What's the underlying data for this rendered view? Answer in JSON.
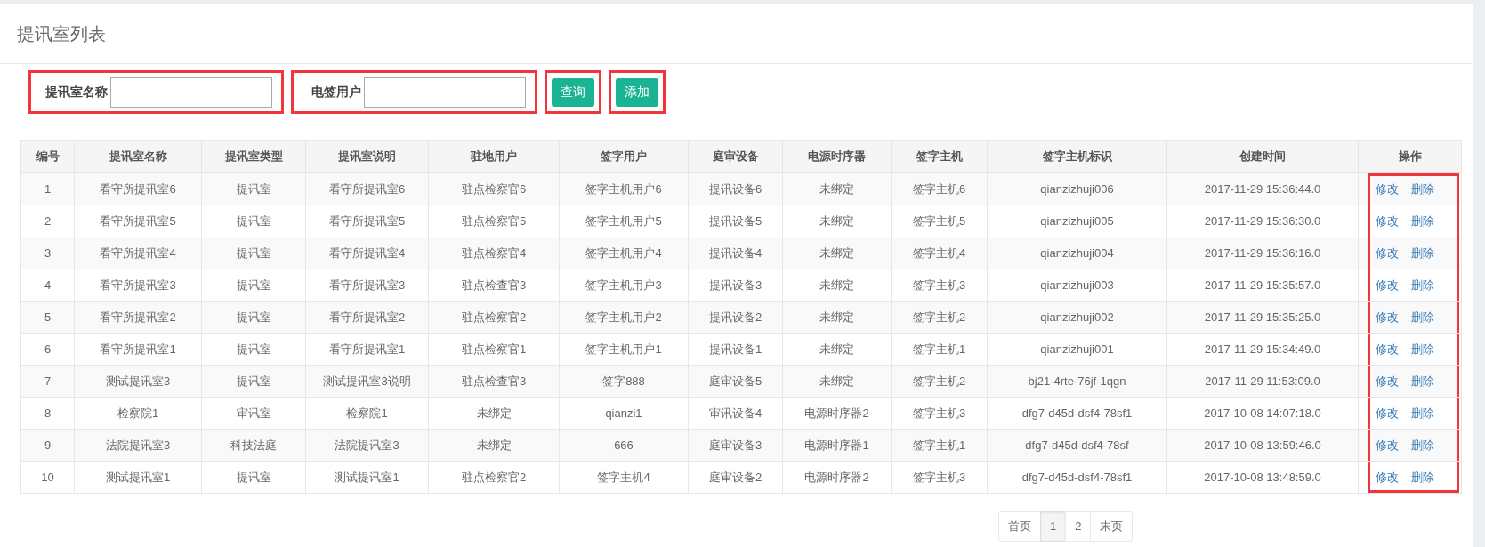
{
  "page": {
    "title": "提讯室列表"
  },
  "filters": [
    {
      "label": "提讯室名称",
      "highlighted": true
    },
    {
      "label": "电签用户",
      "highlighted": true
    }
  ],
  "buttons": [
    {
      "label": "查询",
      "highlighted": true
    },
    {
      "label": "添加",
      "highlighted": true
    }
  ],
  "table": {
    "columns": [
      "编号",
      "提讯室名称",
      "提讯室类型",
      "提讯室说明",
      "驻地用户",
      "签字用户",
      "庭审设备",
      "电源时序器",
      "签字主机",
      "签字主机标识",
      "创建时间",
      "操作"
    ],
    "actions_highlighted": true,
    "rows": [
      {
        "cells": [
          "1",
          "看守所提讯室6",
          "提讯室",
          "看守所提讯室6",
          "驻点检察官6",
          "签字主机用户6",
          "提讯设备6",
          "未绑定",
          "签字主机6",
          "qianzizhuji006",
          "2017-11-29 15:36:44.0"
        ],
        "actions": [
          "修改",
          "删除"
        ]
      },
      {
        "cells": [
          "2",
          "看守所提讯室5",
          "提讯室",
          "看守所提讯室5",
          "驻点检察官5",
          "签字主机用户5",
          "提讯设备5",
          "未绑定",
          "签字主机5",
          "qianzizhuji005",
          "2017-11-29 15:36:30.0"
        ],
        "actions": [
          "修改",
          "删除"
        ]
      },
      {
        "cells": [
          "3",
          "看守所提讯室4",
          "提讯室",
          "看守所提讯室4",
          "驻点检察官4",
          "签字主机用户4",
          "提讯设备4",
          "未绑定",
          "签字主机4",
          "qianzizhuji004",
          "2017-11-29 15:36:16.0"
        ],
        "actions": [
          "修改",
          "删除"
        ]
      },
      {
        "cells": [
          "4",
          "看守所提讯室3",
          "提讯室",
          "看守所提讯室3",
          "驻点检查官3",
          "签字主机用户3",
          "提讯设备3",
          "未绑定",
          "签字主机3",
          "qianzizhuji003",
          "2017-11-29 15:35:57.0"
        ],
        "actions": [
          "修改",
          "删除"
        ]
      },
      {
        "cells": [
          "5",
          "看守所提讯室2",
          "提讯室",
          "看守所提讯室2",
          "驻点检察官2",
          "签字主机用户2",
          "提讯设备2",
          "未绑定",
          "签字主机2",
          "qianzizhuji002",
          "2017-11-29 15:35:25.0"
        ],
        "actions": [
          "修改",
          "删除"
        ]
      },
      {
        "cells": [
          "6",
          "看守所提讯室1",
          "提讯室",
          "看守所提讯室1",
          "驻点检察官1",
          "签字主机用户1",
          "提讯设备1",
          "未绑定",
          "签字主机1",
          "qianzizhuji001",
          "2017-11-29 15:34:49.0"
        ],
        "actions": [
          "修改",
          "删除"
        ]
      },
      {
        "cells": [
          "7",
          "测试提讯室3",
          "提讯室",
          "测试提讯室3说明",
          "驻点检查官3",
          "签字888",
          "庭审设备5",
          "未绑定",
          "签字主机2",
          "bj21-4rte-76jf-1qgn",
          "2017-11-29 11:53:09.0"
        ],
        "actions": [
          "修改",
          "删除"
        ]
      },
      {
        "cells": [
          "8",
          "检察院1",
          "审讯室",
          "检察院1",
          "未绑定",
          "qianzi1",
          "审讯设备4",
          "电源时序器2",
          "签字主机3",
          "dfg7-d45d-dsf4-78sf1",
          "2017-10-08 14:07:18.0"
        ],
        "actions": [
          "修改",
          "删除"
        ]
      },
      {
        "cells": [
          "9",
          "法院提讯室3",
          "科技法庭",
          "法院提讯室3",
          "未绑定",
          "666",
          "庭审设备3",
          "电源时序器1",
          "签字主机1",
          "dfg7-d45d-dsf4-78sf",
          "2017-10-08 13:59:46.0"
        ],
        "actions": [
          "修改",
          "删除"
        ]
      },
      {
        "cells": [
          "10",
          "测试提讯室1",
          "提讯室",
          "测试提讯室1",
          "驻点检察官2",
          "签字主机4",
          "庭审设备2",
          "电源时序器2",
          "签字主机3",
          "dfg7-d45d-dsf4-78sf1",
          "2017-10-08 13:48:59.0"
        ],
        "actions": [
          "修改",
          "删除"
        ]
      }
    ]
  },
  "pagination": [
    {
      "label": "首页",
      "selected": false
    },
    {
      "label": "1",
      "selected": true
    },
    {
      "label": "2",
      "selected": false
    },
    {
      "label": "末页",
      "selected": false
    }
  ]
}
